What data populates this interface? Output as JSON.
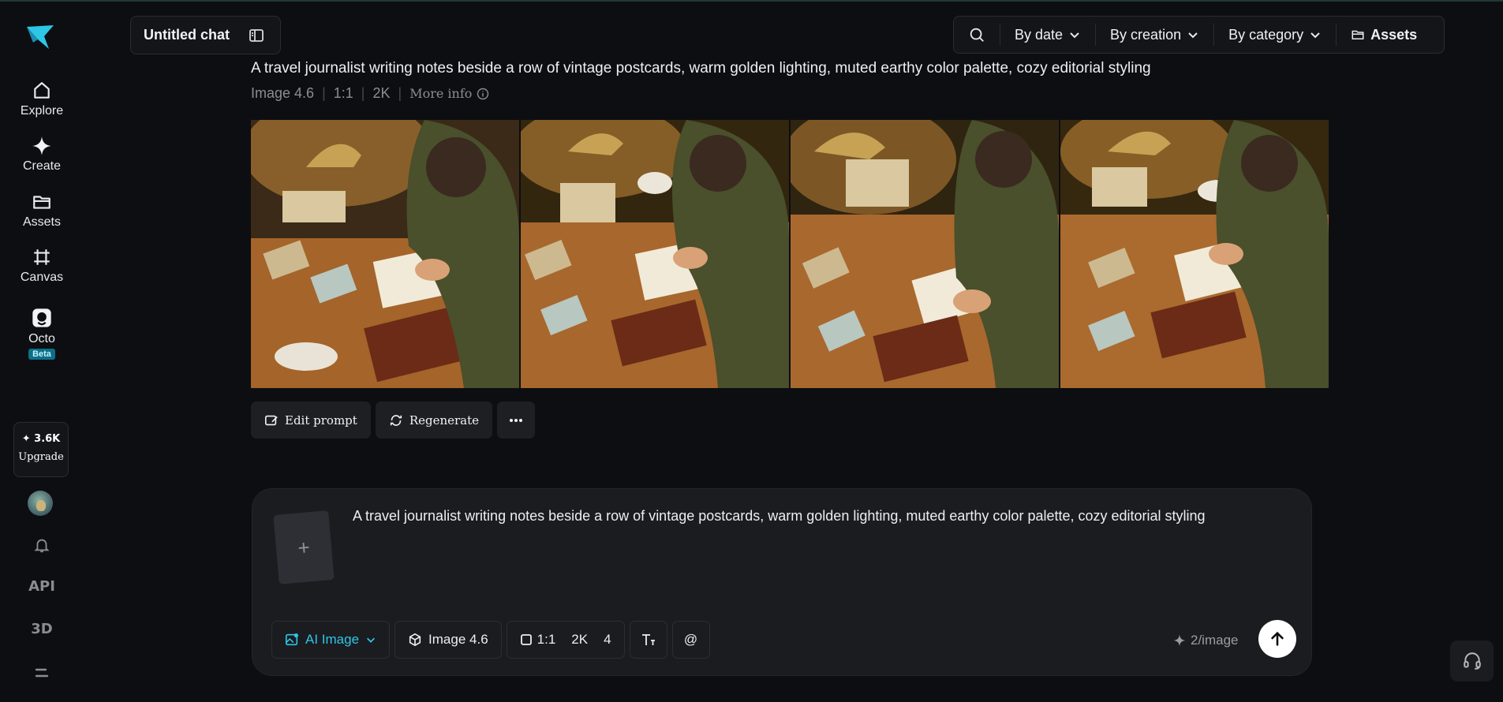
{
  "sidebar": {
    "nav": [
      {
        "label": "Explore",
        "icon": "home-icon"
      },
      {
        "label": "Create",
        "icon": "sparkle-icon"
      },
      {
        "label": "Assets",
        "icon": "folder-icon"
      },
      {
        "label": "Canvas",
        "icon": "canvas-icon"
      },
      {
        "label": "Octo",
        "icon": "octo-icon",
        "badge": "Beta"
      }
    ],
    "credits": "3.6K",
    "upgrade_label": "Upgrade",
    "api_label": "API",
    "three_d_label": "3D"
  },
  "header": {
    "chat_title": "Untitled chat",
    "filters": [
      "By date",
      "By creation",
      "By category"
    ],
    "assets_label": "Assets"
  },
  "generation": {
    "prompt": "A travel journalist writing notes beside a row of vintage postcards, warm golden lighting, muted earthy color palette, cozy editorial styling",
    "model": "Image 4.6",
    "ratio": "1:1",
    "resolution": "2K",
    "more_info": "More info",
    "actions": {
      "edit": "Edit prompt",
      "regenerate": "Regenerate"
    }
  },
  "composer": {
    "prompt_text": "A travel journalist writing notes beside a row of vintage postcards, warm golden lighting, muted earthy color palette, cozy editorial styling",
    "add_symbol": "+",
    "mode": "AI Image",
    "model": "Image 4.6",
    "ratio": "1:1",
    "resolution": "2K",
    "count": "4",
    "mention": "@",
    "cost": "2/image"
  },
  "colors": {
    "accent": "#2ec6e6",
    "background": "#0d0e11",
    "panel": "#1b1c20"
  }
}
